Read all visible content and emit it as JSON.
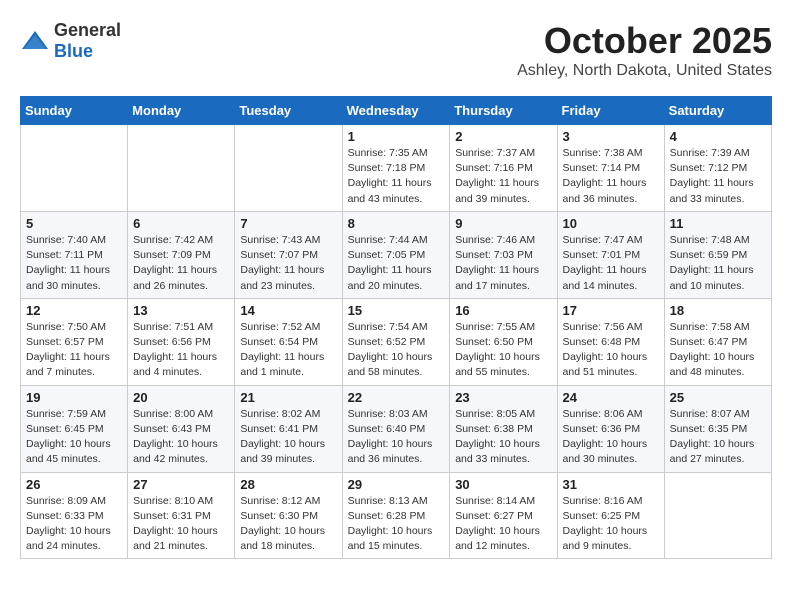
{
  "header": {
    "logo": {
      "general": "General",
      "blue": "Blue"
    },
    "title": "October 2025",
    "location": "Ashley, North Dakota, United States"
  },
  "days_of_week": [
    "Sunday",
    "Monday",
    "Tuesday",
    "Wednesday",
    "Thursday",
    "Friday",
    "Saturday"
  ],
  "weeks": [
    [
      {
        "day": "",
        "sunrise": "",
        "sunset": "",
        "daylight": ""
      },
      {
        "day": "",
        "sunrise": "",
        "sunset": "",
        "daylight": ""
      },
      {
        "day": "",
        "sunrise": "",
        "sunset": "",
        "daylight": ""
      },
      {
        "day": "1",
        "sunrise": "Sunrise: 7:35 AM",
        "sunset": "Sunset: 7:18 PM",
        "daylight": "Daylight: 11 hours and 43 minutes."
      },
      {
        "day": "2",
        "sunrise": "Sunrise: 7:37 AM",
        "sunset": "Sunset: 7:16 PM",
        "daylight": "Daylight: 11 hours and 39 minutes."
      },
      {
        "day": "3",
        "sunrise": "Sunrise: 7:38 AM",
        "sunset": "Sunset: 7:14 PM",
        "daylight": "Daylight: 11 hours and 36 minutes."
      },
      {
        "day": "4",
        "sunrise": "Sunrise: 7:39 AM",
        "sunset": "Sunset: 7:12 PM",
        "daylight": "Daylight: 11 hours and 33 minutes."
      }
    ],
    [
      {
        "day": "5",
        "sunrise": "Sunrise: 7:40 AM",
        "sunset": "Sunset: 7:11 PM",
        "daylight": "Daylight: 11 hours and 30 minutes."
      },
      {
        "day": "6",
        "sunrise": "Sunrise: 7:42 AM",
        "sunset": "Sunset: 7:09 PM",
        "daylight": "Daylight: 11 hours and 26 minutes."
      },
      {
        "day": "7",
        "sunrise": "Sunrise: 7:43 AM",
        "sunset": "Sunset: 7:07 PM",
        "daylight": "Daylight: 11 hours and 23 minutes."
      },
      {
        "day": "8",
        "sunrise": "Sunrise: 7:44 AM",
        "sunset": "Sunset: 7:05 PM",
        "daylight": "Daylight: 11 hours and 20 minutes."
      },
      {
        "day": "9",
        "sunrise": "Sunrise: 7:46 AM",
        "sunset": "Sunset: 7:03 PM",
        "daylight": "Daylight: 11 hours and 17 minutes."
      },
      {
        "day": "10",
        "sunrise": "Sunrise: 7:47 AM",
        "sunset": "Sunset: 7:01 PM",
        "daylight": "Daylight: 11 hours and 14 minutes."
      },
      {
        "day": "11",
        "sunrise": "Sunrise: 7:48 AM",
        "sunset": "Sunset: 6:59 PM",
        "daylight": "Daylight: 11 hours and 10 minutes."
      }
    ],
    [
      {
        "day": "12",
        "sunrise": "Sunrise: 7:50 AM",
        "sunset": "Sunset: 6:57 PM",
        "daylight": "Daylight: 11 hours and 7 minutes."
      },
      {
        "day": "13",
        "sunrise": "Sunrise: 7:51 AM",
        "sunset": "Sunset: 6:56 PM",
        "daylight": "Daylight: 11 hours and 4 minutes."
      },
      {
        "day": "14",
        "sunrise": "Sunrise: 7:52 AM",
        "sunset": "Sunset: 6:54 PM",
        "daylight": "Daylight: 11 hours and 1 minute."
      },
      {
        "day": "15",
        "sunrise": "Sunrise: 7:54 AM",
        "sunset": "Sunset: 6:52 PM",
        "daylight": "Daylight: 10 hours and 58 minutes."
      },
      {
        "day": "16",
        "sunrise": "Sunrise: 7:55 AM",
        "sunset": "Sunset: 6:50 PM",
        "daylight": "Daylight: 10 hours and 55 minutes."
      },
      {
        "day": "17",
        "sunrise": "Sunrise: 7:56 AM",
        "sunset": "Sunset: 6:48 PM",
        "daylight": "Daylight: 10 hours and 51 minutes."
      },
      {
        "day": "18",
        "sunrise": "Sunrise: 7:58 AM",
        "sunset": "Sunset: 6:47 PM",
        "daylight": "Daylight: 10 hours and 48 minutes."
      }
    ],
    [
      {
        "day": "19",
        "sunrise": "Sunrise: 7:59 AM",
        "sunset": "Sunset: 6:45 PM",
        "daylight": "Daylight: 10 hours and 45 minutes."
      },
      {
        "day": "20",
        "sunrise": "Sunrise: 8:00 AM",
        "sunset": "Sunset: 6:43 PM",
        "daylight": "Daylight: 10 hours and 42 minutes."
      },
      {
        "day": "21",
        "sunrise": "Sunrise: 8:02 AM",
        "sunset": "Sunset: 6:41 PM",
        "daylight": "Daylight: 10 hours and 39 minutes."
      },
      {
        "day": "22",
        "sunrise": "Sunrise: 8:03 AM",
        "sunset": "Sunset: 6:40 PM",
        "daylight": "Daylight: 10 hours and 36 minutes."
      },
      {
        "day": "23",
        "sunrise": "Sunrise: 8:05 AM",
        "sunset": "Sunset: 6:38 PM",
        "daylight": "Daylight: 10 hours and 33 minutes."
      },
      {
        "day": "24",
        "sunrise": "Sunrise: 8:06 AM",
        "sunset": "Sunset: 6:36 PM",
        "daylight": "Daylight: 10 hours and 30 minutes."
      },
      {
        "day": "25",
        "sunrise": "Sunrise: 8:07 AM",
        "sunset": "Sunset: 6:35 PM",
        "daylight": "Daylight: 10 hours and 27 minutes."
      }
    ],
    [
      {
        "day": "26",
        "sunrise": "Sunrise: 8:09 AM",
        "sunset": "Sunset: 6:33 PM",
        "daylight": "Daylight: 10 hours and 24 minutes."
      },
      {
        "day": "27",
        "sunrise": "Sunrise: 8:10 AM",
        "sunset": "Sunset: 6:31 PM",
        "daylight": "Daylight: 10 hours and 21 minutes."
      },
      {
        "day": "28",
        "sunrise": "Sunrise: 8:12 AM",
        "sunset": "Sunset: 6:30 PM",
        "daylight": "Daylight: 10 hours and 18 minutes."
      },
      {
        "day": "29",
        "sunrise": "Sunrise: 8:13 AM",
        "sunset": "Sunset: 6:28 PM",
        "daylight": "Daylight: 10 hours and 15 minutes."
      },
      {
        "day": "30",
        "sunrise": "Sunrise: 8:14 AM",
        "sunset": "Sunset: 6:27 PM",
        "daylight": "Daylight: 10 hours and 12 minutes."
      },
      {
        "day": "31",
        "sunrise": "Sunrise: 8:16 AM",
        "sunset": "Sunset: 6:25 PM",
        "daylight": "Daylight: 10 hours and 9 minutes."
      },
      {
        "day": "",
        "sunrise": "",
        "sunset": "",
        "daylight": ""
      }
    ]
  ]
}
